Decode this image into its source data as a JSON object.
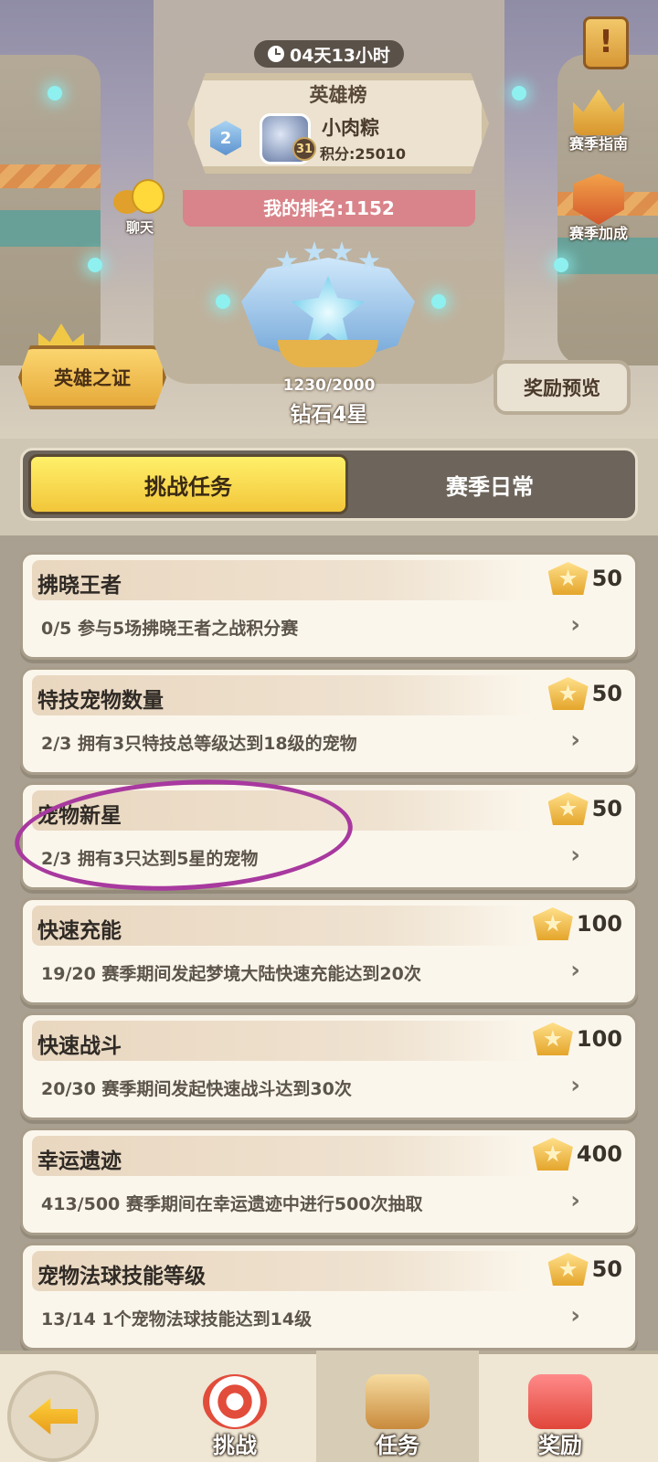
{
  "header": {
    "timer": "04天13小时",
    "board_title": "英雄榜",
    "top_player": {
      "rank": "2",
      "name": "小肉粽",
      "level": "31",
      "score": "积分:25010"
    },
    "my_rank": "我的排名:1152",
    "chat_label": "聊天",
    "season_guide": "赛季指南",
    "season_bonus": "赛季加成",
    "hero_proof": "英雄之证",
    "reward_preview": "奖励预览",
    "points": "1230/2000",
    "tier": "钻石4星"
  },
  "tabs": [
    {
      "label": "挑战任务",
      "active": true
    },
    {
      "label": "赛季日常",
      "active": false
    }
  ],
  "tasks": [
    {
      "title": "拂晓王者",
      "desc": "0/5  参与5场拂晓王者之战积分赛",
      "reward": "50"
    },
    {
      "title": "特技宠物数量",
      "desc": "2/3  拥有3只特技总等级达到18级的宠物",
      "reward": "50"
    },
    {
      "title": "宠物新星",
      "desc": "2/3  拥有3只达到5星的宠物",
      "reward": "50"
    },
    {
      "title": "快速充能",
      "desc": "19/20  赛季期间发起梦境大陆快速充能达到20次",
      "reward": "100"
    },
    {
      "title": "快速战斗",
      "desc": "20/30  赛季期间发起快速战斗达到30次",
      "reward": "100"
    },
    {
      "title": "幸运遗迹",
      "desc": "413/500  赛季期间在幸运遗迹中进行500次抽取",
      "reward": "400"
    },
    {
      "title": "宠物法球技能等级",
      "desc": "13/14  1个宠物法球技能达到14级",
      "reward": "50"
    }
  ],
  "bottom_nav": [
    {
      "label": "挑战",
      "icon": "target-icon"
    },
    {
      "label": "任务",
      "icon": "scroll-chest-icon",
      "selected": true
    },
    {
      "label": "奖励",
      "icon": "gift-box-icon"
    }
  ],
  "colors": {
    "accent_yellow": "#f2c63a",
    "annotation_circle": "#a8399f"
  }
}
